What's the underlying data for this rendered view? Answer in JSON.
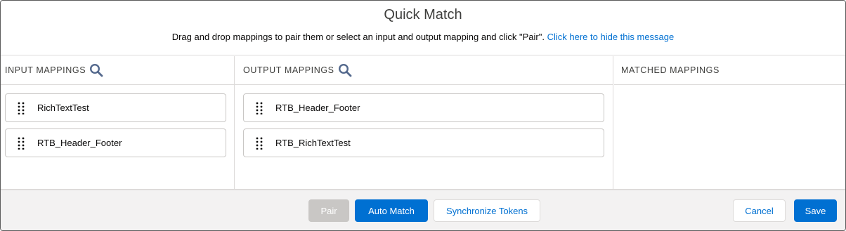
{
  "modal": {
    "title": "Quick Match",
    "message": "Drag and drop mappings to pair them or select an input and output mapping and click \"Pair\".",
    "hide_link": "Click here to hide this message"
  },
  "columns": {
    "input": {
      "header": "INPUT MAPPINGS",
      "items": [
        {
          "label": "RichTextTest"
        },
        {
          "label": "RTB_Header_Footer"
        }
      ]
    },
    "output": {
      "header": "OUTPUT MAPPINGS",
      "items": [
        {
          "label": "RTB_Header_Footer"
        },
        {
          "label": "RTB_RichTextTest"
        }
      ]
    },
    "matched": {
      "header": "MATCHED MAPPINGS",
      "items": []
    }
  },
  "footer": {
    "pair_label": "Pair",
    "auto_match_label": "Auto Match",
    "synchronize_label": "Synchronize Tokens",
    "cancel_label": "Cancel",
    "save_label": "Save"
  },
  "colors": {
    "brand": "#0070d2",
    "disabled": "#c9c7c5",
    "border": "#dddbda",
    "footer_bg": "#f3f2f2"
  },
  "icons": {
    "search": "search-icon",
    "drag": "drag-handle-icon"
  }
}
